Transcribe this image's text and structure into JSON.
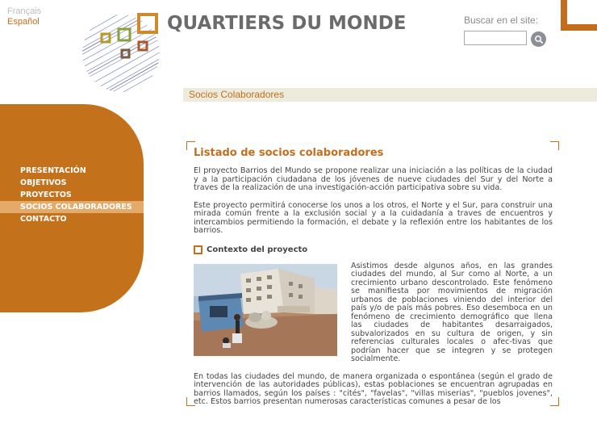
{
  "languages": [
    "Français",
    "Español"
  ],
  "site": {
    "title": "QUARTIERS DU MONDE"
  },
  "search": {
    "label": "Buscar en el site:",
    "value": "",
    "placeholder": ""
  },
  "breadcrumb": "Socios Colaboradores",
  "nav": {
    "items": [
      "PRESENTACIÓN",
      "OBJETIVOS",
      "PROYECTOS",
      "SOCIOS COLABORADORES",
      "CONTACTO"
    ],
    "active_index": 3
  },
  "main": {
    "title": "Listado de socios colaboradores",
    "paragraphs": [
      "El proyecto Barrios del Mundo se propone realizar una iniciación a las políticas de la ciudad y a la participación ciudadana de los jóvenes de nueve ciudades del Sur y del Norte a traves de la realización de una investigación-acción participativa sobre su vida.",
      "Este proyecto permitirá conocerse los unos a los otros, el Norte y el Sur, para construir una mirada común frente a la exclusión social y a la cuidadanía a traves de encuentros y intercambios permitiendo la formación, el debate y la reflexión entre los habitantes de los barrios."
    ],
    "section_title": "Contexto del proyecto",
    "side_text": "Asistimos desde algunos años, en las grandes ciudades del mundo, al Sur como al Norte, a un crecimiento urbano descontrolado. Este fenómeno se manifiesta por movimientos de migración urbanos de poblaciones viniendo del interior del país y/o de país más pobres. Eso desemboca en un fenómeno de crecimiento demográfico que llena las ciudades de habitantes desarraigados, subvalorizados en su cultura de origen, y sin referencias culturales locales o afec-tivas que podrían hacer que se integren y se protegen socialmente.",
    "paragraph_bottom": "En todas las ciudades del mundo, de manera organizada o espontánea (según el grado de intervención de las autoridades públicas), estas poblaciones se encuentran agrupadas en barrios llamados, según los países : \"cités\", \"favelas\", \"villas miserias\", \"pueblos jovenes\", etc. Estos barrios presentan numerosas características comunes a pesar de los"
  },
  "colors": {
    "accent": "#c46e1d",
    "nav_background": "#c4711c",
    "nav_active": "#e3aa6a",
    "breadcrumb_bar": "#ecebdc",
    "title_gray": "#6b6b6b"
  },
  "icons": {
    "search": "search-icon"
  }
}
